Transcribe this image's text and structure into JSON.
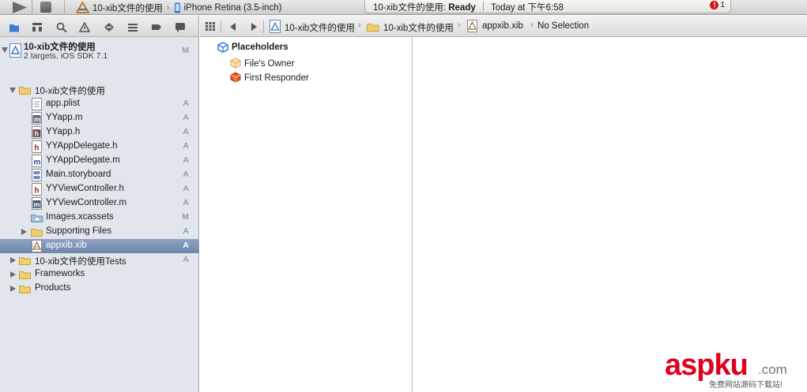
{
  "toolbar": {
    "run_label": "Run",
    "stop_label": "Stop",
    "scheme_name": "10-xib文件的使用",
    "device": "iPhone Retina (3.5-inch)",
    "activity_prefix": "10-xib文件的使用: ",
    "activity_status": "Ready",
    "activity_time": "Today at 下午6:58",
    "error_count": "1"
  },
  "navigator": {
    "tabs": [
      "project-navigator",
      "symbol-navigator",
      "find-navigator",
      "issue-navigator",
      "test-navigator",
      "debug-navigator",
      "breakpoint-navigator",
      "log-navigator"
    ],
    "project": {
      "name": "10-xib文件的使用",
      "subtitle": "2 targets, iOS SDK 7.1",
      "badge": "M"
    },
    "group": {
      "name": "10-xib文件的使用"
    },
    "files": [
      {
        "name": "app.plist",
        "badge": "A",
        "kind": "plist"
      },
      {
        "name": "YYapp.m",
        "badge": "A",
        "kind": "m"
      },
      {
        "name": "YYapp.h",
        "badge": "A",
        "kind": "h"
      },
      {
        "name": "YYAppDelegate.h",
        "badge": "A",
        "kind": "h"
      },
      {
        "name": "YYAppDelegate.m",
        "badge": "A",
        "kind": "m"
      },
      {
        "name": "Main.storyboard",
        "badge": "A",
        "kind": "storyboard"
      },
      {
        "name": "YYViewController.h",
        "badge": "A",
        "kind": "h"
      },
      {
        "name": "YYViewController.m",
        "badge": "A",
        "kind": "m"
      },
      {
        "name": "Images.xcassets",
        "badge": "M",
        "kind": "xcassets"
      }
    ],
    "supporting": {
      "name": "Supporting Files",
      "badge": "A"
    },
    "selected": {
      "name": "appxib.xib",
      "badge": "A"
    },
    "tests_group": {
      "name": "10-xib文件的使用Tests",
      "badge": "A"
    },
    "frameworks": {
      "name": "Frameworks"
    },
    "products": {
      "name": "Products"
    }
  },
  "jumpbar": {
    "project": "10-xib文件的使用",
    "group": "10-xib文件的使用",
    "file": "appxib.xib",
    "selection": "No Selection"
  },
  "outline": {
    "section": "Placeholders",
    "items": [
      "File's Owner",
      "First Responder"
    ]
  },
  "watermark": {
    "brand": "aspku",
    "domain": ".com",
    "tagline": "免费网站源码下载站!"
  }
}
